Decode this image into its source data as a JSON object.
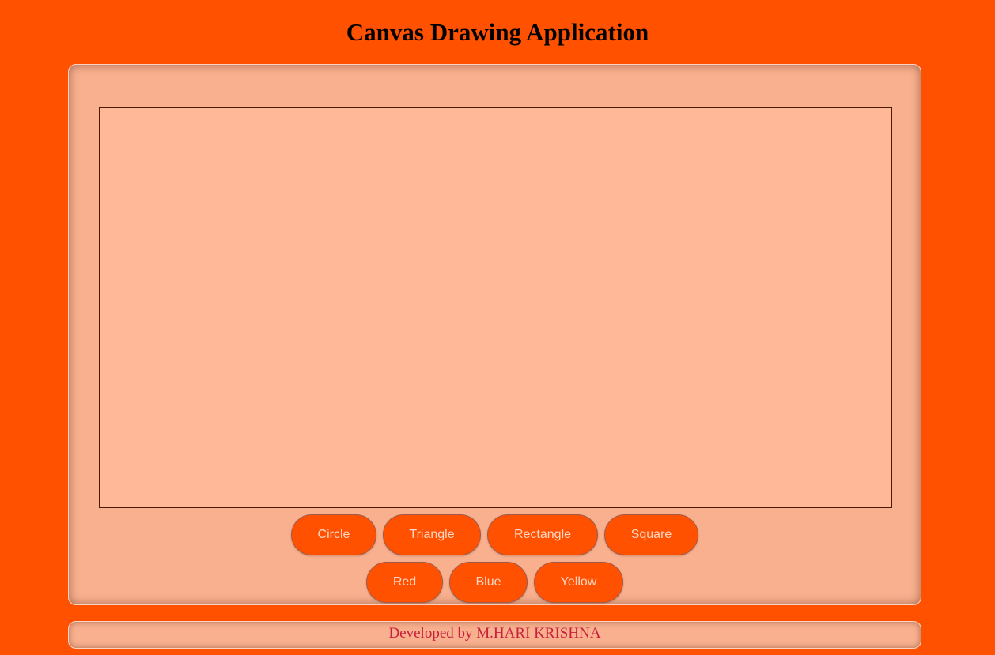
{
  "page": {
    "title": "Canvas Drawing Application"
  },
  "shapes": {
    "circle": "Circle",
    "triangle": "Triangle",
    "rectangle": "Rectangle",
    "square": "Square"
  },
  "colors": {
    "red": "Red",
    "blue": "Blue",
    "yellow": "Yellow"
  },
  "footer": {
    "text": "Developed by M.HARI KRISHNA"
  },
  "theme": {
    "background": "#ff5100",
    "panel": "#f8b08f",
    "canvas": "#ffb898",
    "button": "#ff5100",
    "button_text": "#ffd7c4",
    "footer_text": "#c8203c"
  }
}
